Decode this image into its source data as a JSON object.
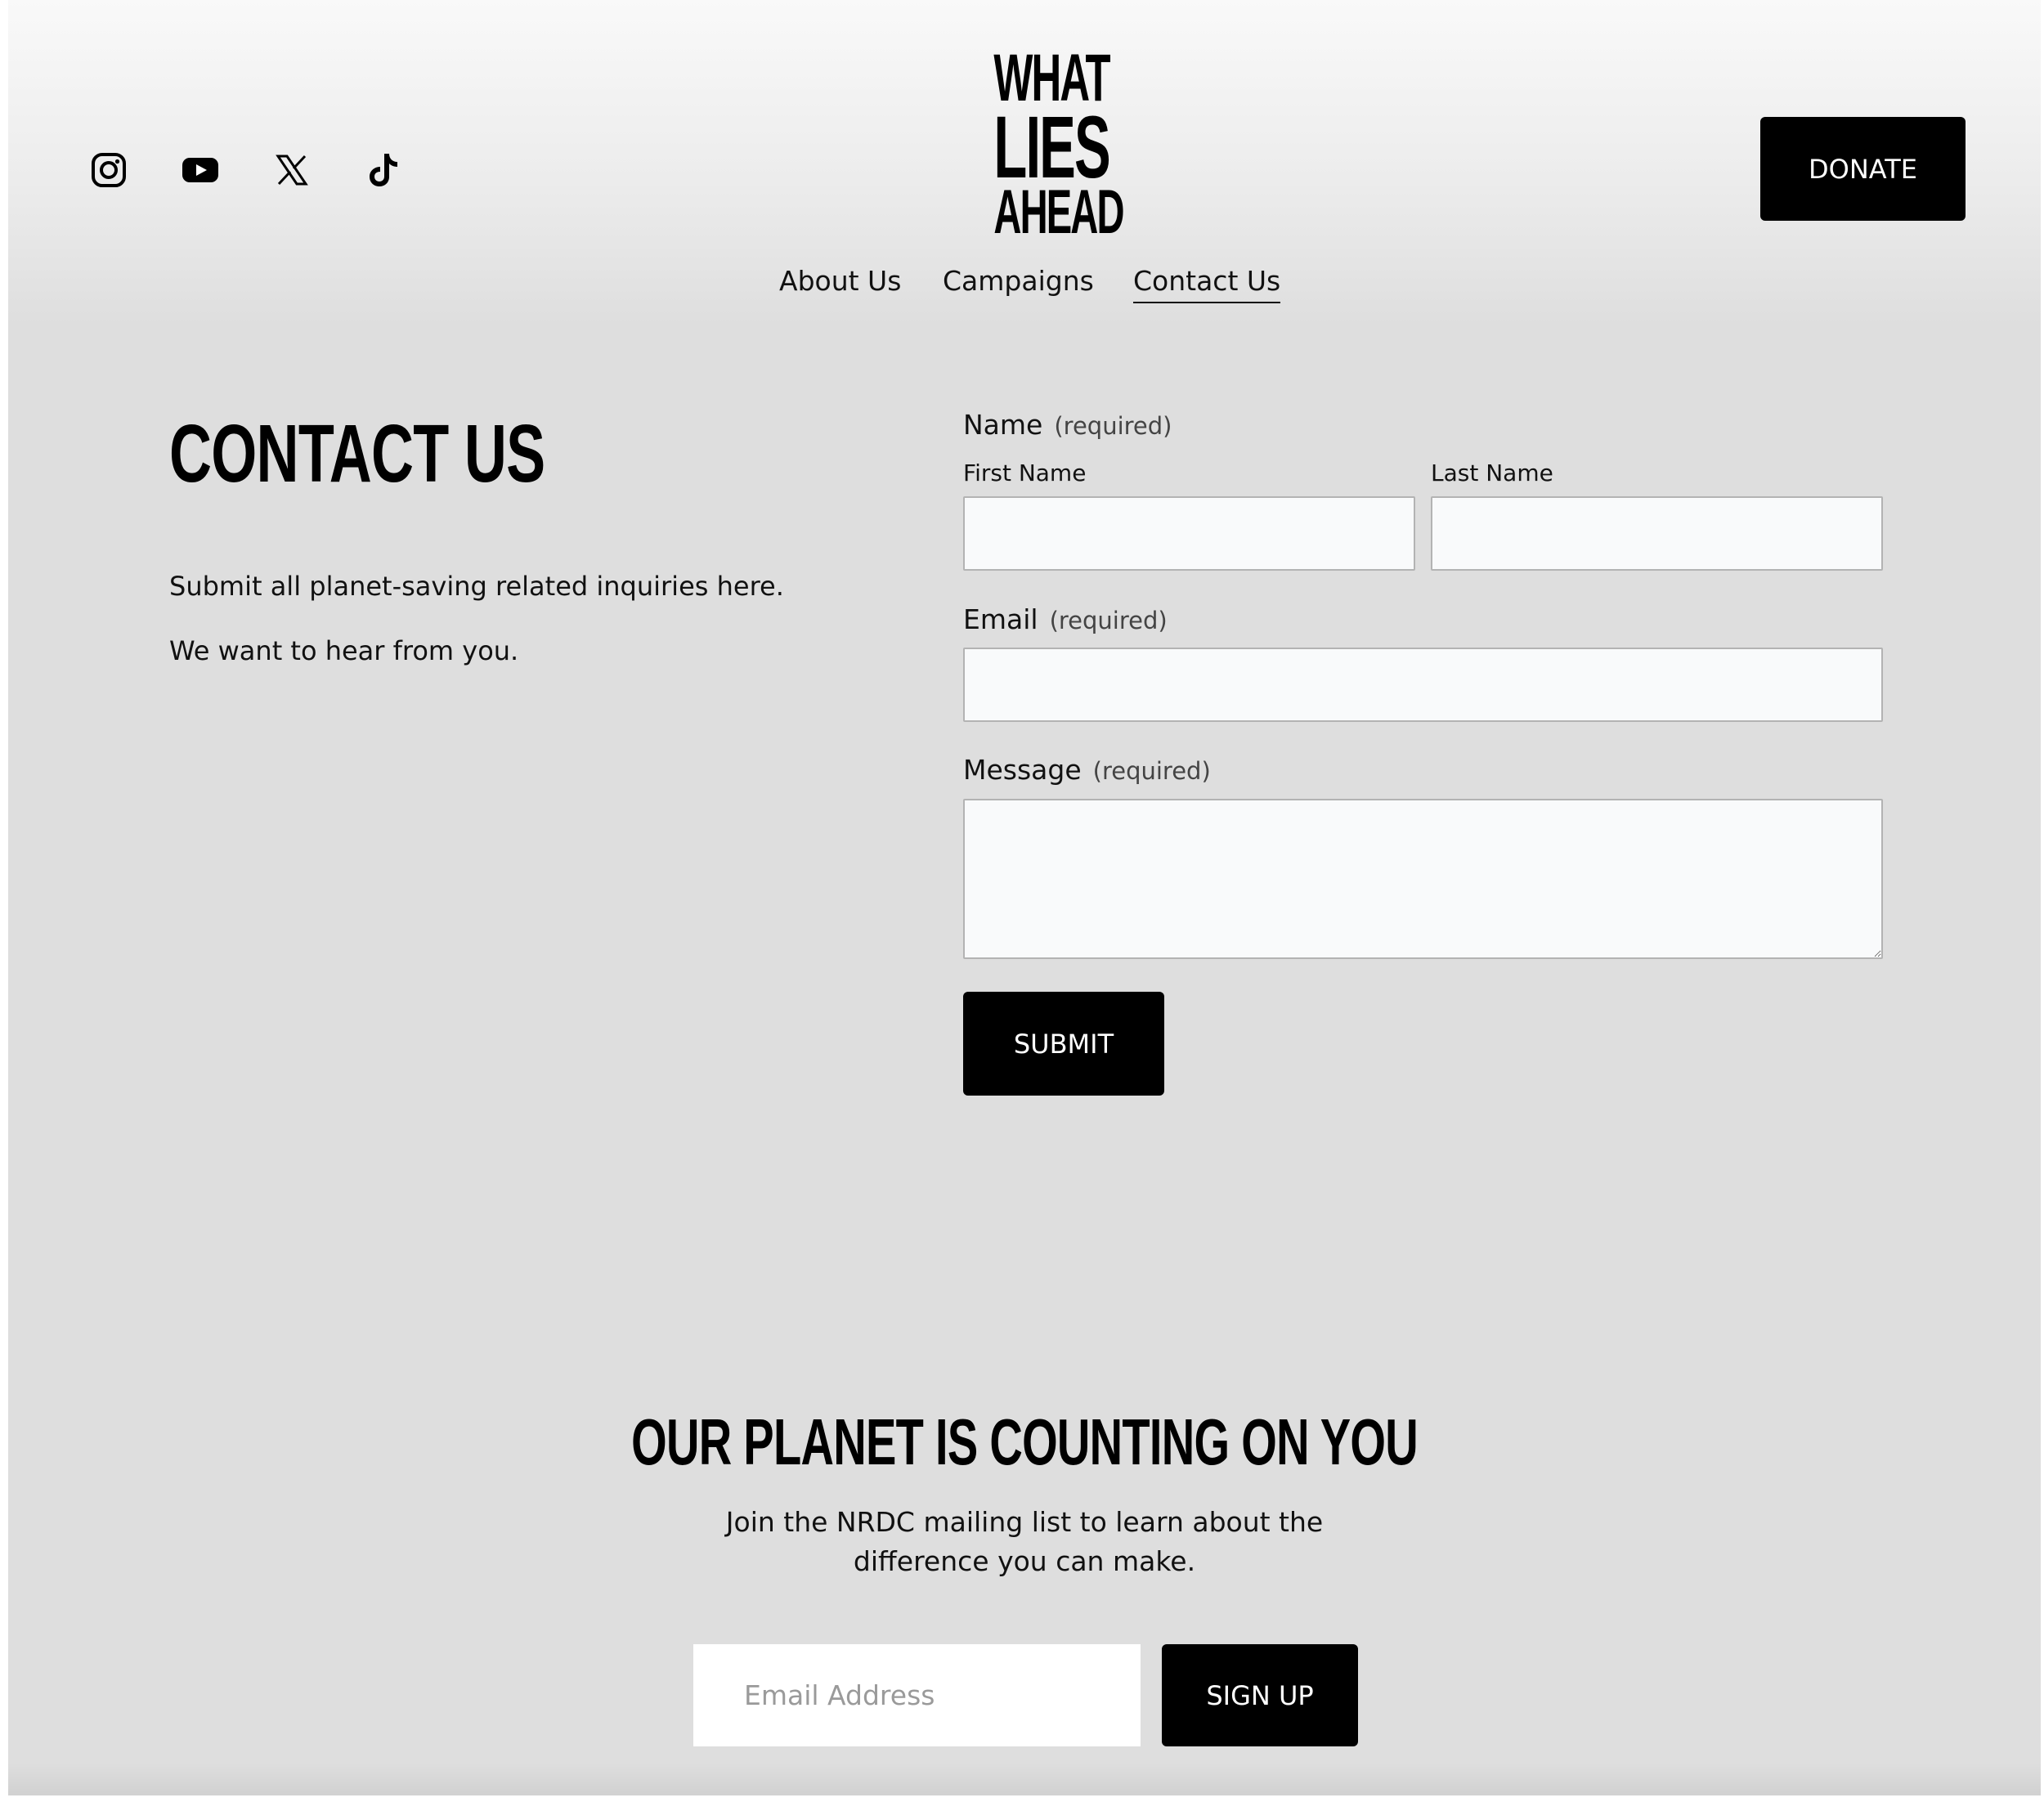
{
  "header": {
    "social_icons": [
      "instagram-icon",
      "youtube-icon",
      "x-icon",
      "tiktok-icon"
    ],
    "logo_lines": [
      "WHAT",
      "LIES",
      "AHEAD"
    ],
    "donate_label": "DONATE",
    "nav": [
      {
        "label": "About Us"
      },
      {
        "label": "Campaigns"
      },
      {
        "label": "Contact Us",
        "active": true
      }
    ]
  },
  "contact": {
    "title": "CONTACT US",
    "intro_1": "Submit all planet-saving related inquiries here.",
    "intro_2": "We want to hear from you."
  },
  "form": {
    "name_label": "Name",
    "required_text": "(required)",
    "first_name_label": "First Name",
    "last_name_label": "Last Name",
    "first_name_value": "",
    "last_name_value": "",
    "email_label": "Email",
    "email_value": "",
    "message_label": "Message",
    "message_value": "",
    "submit_label": "SUBMIT"
  },
  "newsletter": {
    "title": "OUR PLANET IS COUNTING ON YOU",
    "subtitle_line1": "Join the NRDC mailing list to learn about the",
    "subtitle_line2": "difference you can make.",
    "email_placeholder": "Email Address",
    "signup_label": "SIGN UP"
  },
  "colors": {
    "background": "#dedede",
    "button": "#000000",
    "button_text": "#ffffff",
    "field": "#f9fafb"
  }
}
